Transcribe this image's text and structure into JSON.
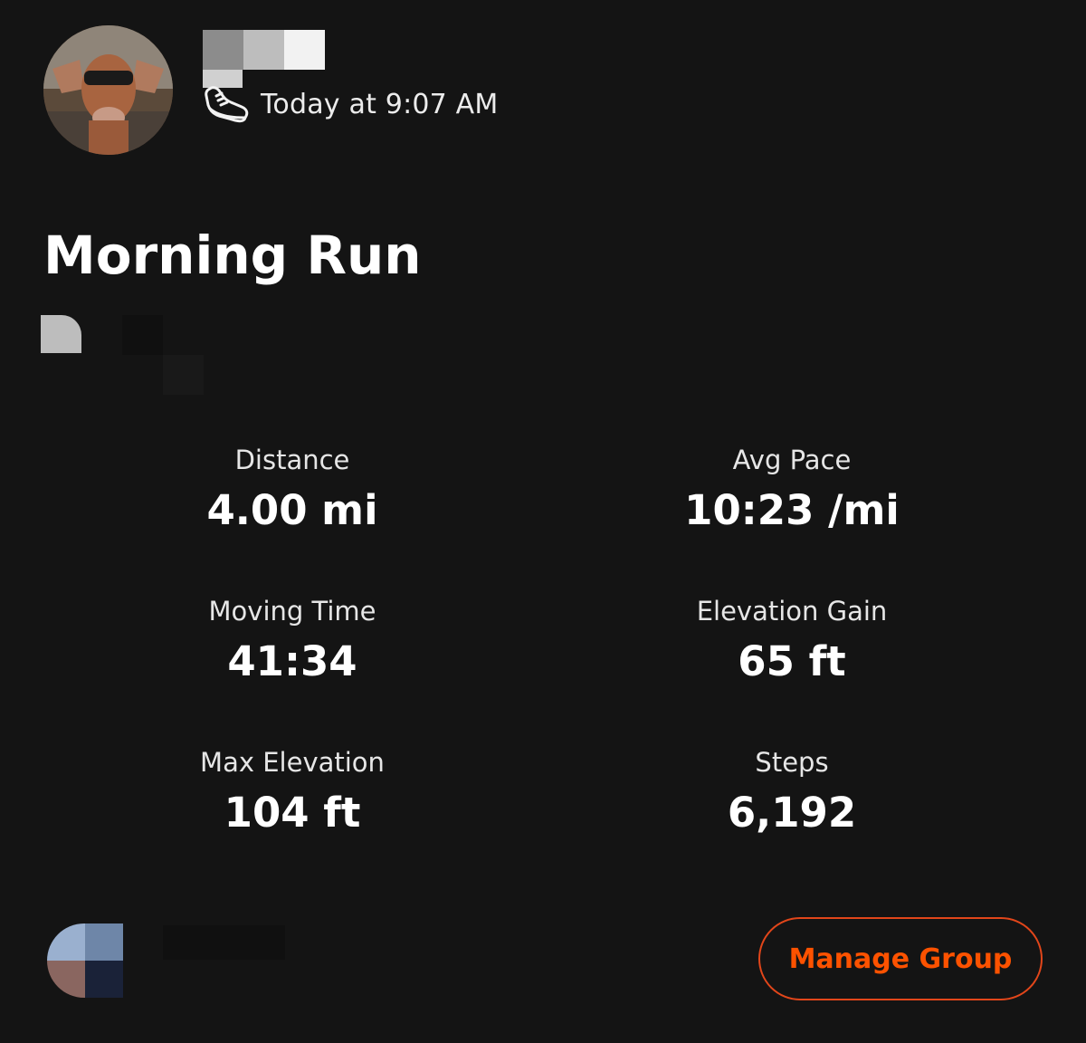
{
  "activity": {
    "timestamp": "Today at 9:07 AM",
    "activity_icon": "running-shoe-icon",
    "title": "Morning Run"
  },
  "stats": [
    {
      "label": "Distance",
      "value": "4.00 mi"
    },
    {
      "label": "Avg Pace",
      "value": "10:23 /mi"
    },
    {
      "label": "Moving Time",
      "value": "41:34"
    },
    {
      "label": "Elevation Gain",
      "value": "65 ft"
    },
    {
      "label": "Max Elevation",
      "value": "104 ft"
    },
    {
      "label": "Steps",
      "value": "6,192"
    }
  ],
  "footer": {
    "manage_group_label": "Manage Group"
  },
  "colors": {
    "background": "#141414",
    "accent": "#fc5200",
    "text": "#ffffff"
  }
}
